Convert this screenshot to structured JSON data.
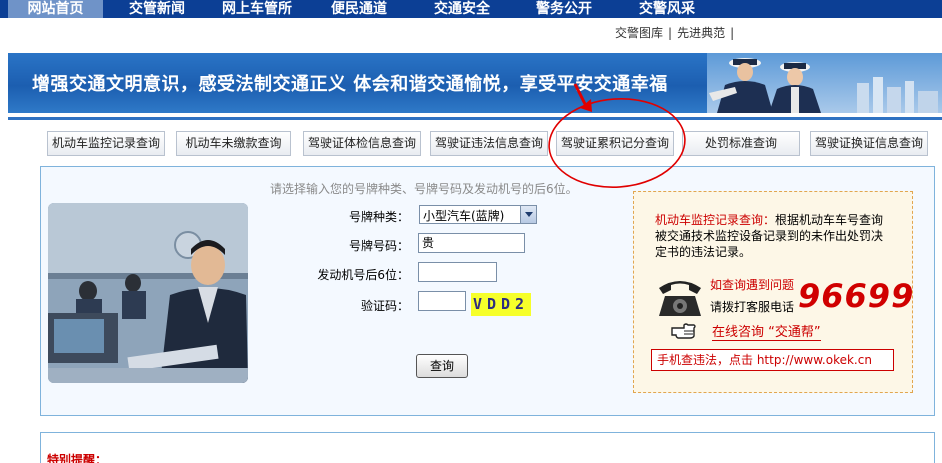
{
  "nav": {
    "items": [
      "网站首页",
      "交管新闻",
      "网上车管所",
      "便民通道",
      "交通安全",
      "警务公开",
      "交警风采"
    ]
  },
  "sublinks": [
    "交警图库",
    "先进典范"
  ],
  "banner": {
    "slogan": "增强交通文明意识，感受法制交通正义   体会和谐交通愉悦，享受平安交通幸福"
  },
  "query_tabs": [
    "机动车监控记录查询",
    "机动车未缴款查询",
    "驾驶证体检信息查询",
    "驾驶证违法信息查询",
    "驾驶证累积记分查询",
    "处罚标准查询",
    "驾驶证换证信息查询"
  ],
  "form": {
    "hint": "请选择输入您的号牌种类、号牌号码及发动机号的后6位。",
    "plate_type_label": "号牌种类：",
    "plate_type_value": "小型汽车(蓝牌)",
    "plate_no_label": "号牌号码：",
    "plate_no_value": "贵",
    "engine_label": "发动机号后6位：",
    "engine_value": "",
    "captcha_label": "验证码：",
    "captcha_value": "",
    "captcha_text": "VDD2",
    "submit_label": "查询"
  },
  "info": {
    "title": "机动车监控记录查询：",
    "body": "根据机动车车号查询被交通技术监控设备记录到的未作出处罚决定书的违法记录。",
    "ask": "如查询遇到问题",
    "call": "请拨打客服电话",
    "hotline": "96699",
    "consult": "在线咨询 “交通帮”",
    "mobile": "手机查违法，点击 http://www.okek.cn"
  },
  "notice": "特别提醒：",
  "colors": {
    "nav_bg": "#0c3f95",
    "nav_active": "#6f93c8",
    "accent_red": "#c00000",
    "annotation_red": "#e00000"
  }
}
